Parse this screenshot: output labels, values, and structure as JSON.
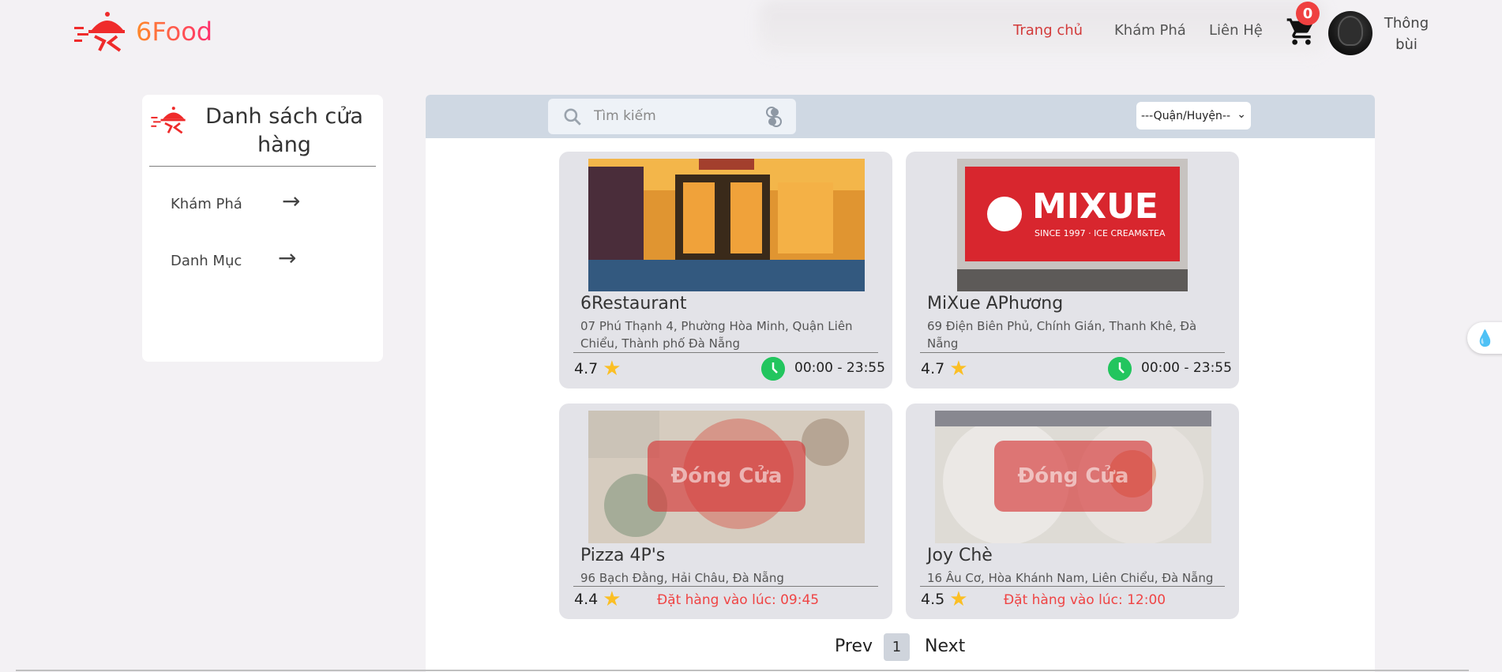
{
  "brand": {
    "name": "6Food"
  },
  "nav": {
    "home": "Trang chủ",
    "explore": "Khám Phá",
    "contact": "Liên Hệ"
  },
  "cart": {
    "count": "0"
  },
  "user": {
    "name_line1": "Thông",
    "name_line2": "bùi"
  },
  "sidebar": {
    "title": "Danh sách cửa hàng",
    "items": [
      {
        "label": "Khám Phá"
      },
      {
        "label": "Danh Mục"
      }
    ]
  },
  "toolbar": {
    "search_placeholder": "Tìm kiếm",
    "district_select": "---Quận/Huyện--"
  },
  "stores": [
    {
      "name": "6Restaurant",
      "address": "07 Phú Thạnh 4, Phường Hòa Minh, Quận Liên Chiểu, Thành phố Đà Nẵng",
      "rating": "4.7",
      "hours": "00:00 - 23:55",
      "status": "open"
    },
    {
      "name": "MiXue APhương",
      "address": "69 Điện Biên Phủ, Chính Gián, Thanh Khê, Đà Nẵng",
      "rating": "4.7",
      "hours": "00:00 - 23:55",
      "status": "open"
    },
    {
      "name": "Pizza 4P's",
      "address": "96 Bạch Đằng, Hải Châu, Đà Nẵng",
      "rating": "4.4",
      "order_time": "Đặt hàng vào lúc: 09:45",
      "status": "closed",
      "closed_label": "Đóng Cửa"
    },
    {
      "name": "Joy Chè",
      "address": "16 Âu Cơ, Hòa Khánh Nam, Liên Chiểu, Đà Nẵng",
      "rating": "4.5",
      "order_time": "Đặt hàng vào lúc: 12:00",
      "status": "closed",
      "closed_label": "Đóng Cửa"
    }
  ],
  "mixue_sign": {
    "brand": "MIXUE",
    "tagline": "SINCE 1997 · ICE CREAM&TEA"
  },
  "pagination": {
    "prev": "Prev",
    "current": "1",
    "next": "Next"
  },
  "colors": {
    "accent": "#d33a3a",
    "badge": "#ef4040",
    "open_clock": "#22c55e",
    "star": "#fbbf24",
    "toolbar": "#cfd8e3"
  }
}
